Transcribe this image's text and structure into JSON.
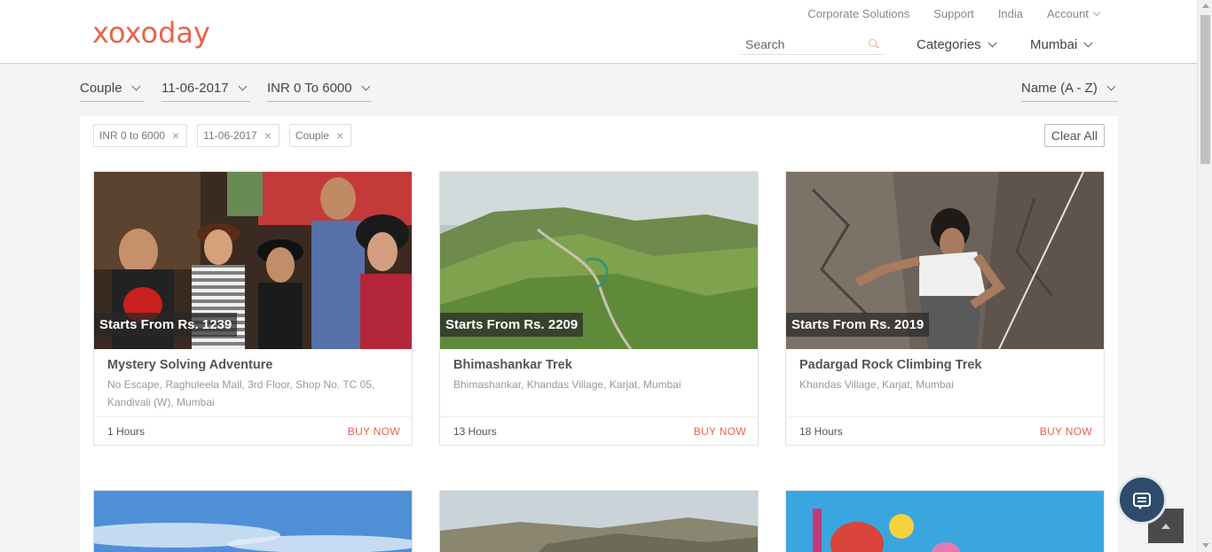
{
  "header": {
    "logo": "xoxoday",
    "top_links": [
      "Corporate Solutions",
      "Support",
      "India",
      "Account"
    ],
    "search_placeholder": "Search",
    "categories_label": "Categories",
    "city_label": "Mumbai"
  },
  "filters": {
    "group": "Couple",
    "date": "11-06-2017",
    "price": "INR 0 To 6000",
    "sort": "Name (A - Z)"
  },
  "chips": [
    "INR 0 to 6000",
    "11-06-2017",
    "Couple"
  ],
  "clear_all": "Clear All",
  "cards": [
    {
      "price_tag": "Starts From Rs. 1239",
      "title": "Mystery Solving Adventure",
      "address": "No Escape, Raghuleela Mall, 3rd Floor, Shop No. TC 05, Kandivali (W), Mumbai",
      "duration": "1 Hours",
      "buy": "BUY NOW"
    },
    {
      "price_tag": "Starts From Rs. 2209",
      "title": "Bhimashankar Trek",
      "address": "Bhimashankar, Khandas Village, Karjat, Mumbai",
      "duration": "13 Hours",
      "buy": "BUY NOW"
    },
    {
      "price_tag": "Starts From Rs. 2019",
      "title": "Padargad Rock Climbing Trek",
      "address": "Khandas Village, Karjat, Mumbai",
      "duration": "18 Hours",
      "buy": "BUY NOW"
    }
  ],
  "icons": {
    "search": "search-icon",
    "chat": "chat-icon",
    "back_to_top": "arrow-up-icon"
  },
  "colors": {
    "brand": "#e8634d",
    "chat_button": "#2f4b6b"
  }
}
